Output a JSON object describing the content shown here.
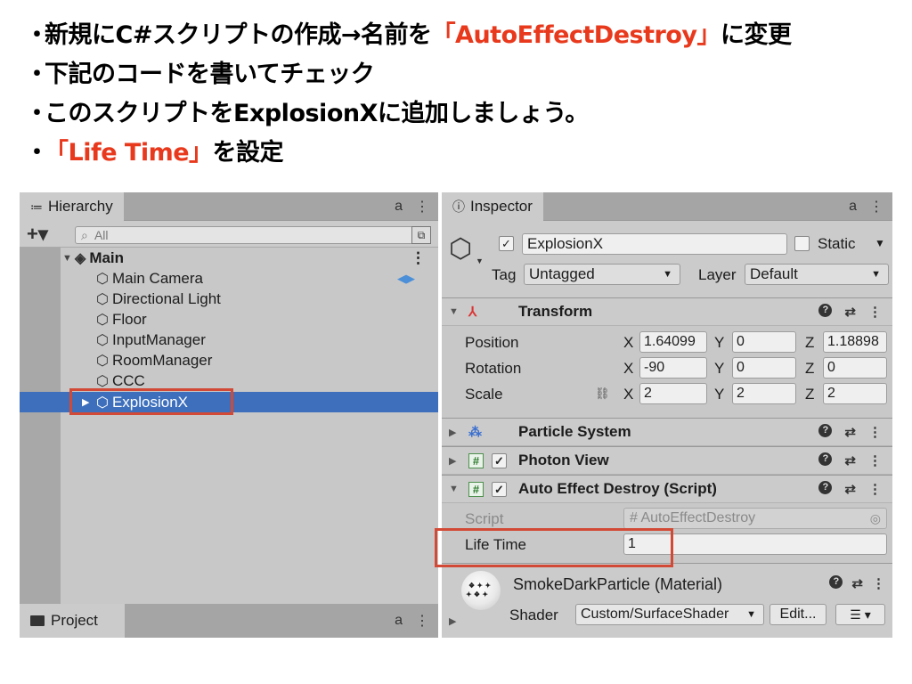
{
  "slide": {
    "bullets": [
      {
        "prefix": "新規にC#スクリプトの作成→名前を",
        "highlight": "「AutoEffectDestroy」",
        "suffix": "に変更"
      },
      {
        "prefix": "下記のコードを書いてチェック",
        "highlight": "",
        "suffix": ""
      },
      {
        "prefix": "このスクリプトをExplosionXに追加しましょう。",
        "highlight": "",
        "suffix": ""
      },
      {
        "prefix": "",
        "highlight": "「Life Time」",
        "suffix": "を設定"
      }
    ],
    "bullet_mark": "・",
    "highlight_color": "#e8391d",
    "annotation_color": "#d24a36"
  },
  "hierarchy": {
    "tab_label": "Hierarchy",
    "tab_icon": "≔",
    "lock_icon": "a",
    "menu_icon": "⋮",
    "add_label": "+▾",
    "search_icon": "⌕",
    "search_placeholder": "All",
    "scene_picker_icon": "⧉",
    "scene": "Main",
    "items": [
      {
        "label": "Main Camera",
        "badge": "◀▶"
      },
      {
        "label": "Directional Light"
      },
      {
        "label": "Floor"
      },
      {
        "label": "InputManager"
      },
      {
        "label": "RoomManager"
      },
      {
        "label": "CCC"
      },
      {
        "label": "ExplosionX",
        "selected": true
      }
    ],
    "project_tab": "Project"
  },
  "inspector": {
    "tab_label": "Inspector",
    "tab_icon": "ⓘ",
    "object_name": "ExplosionX",
    "active_check": "✓",
    "static_label": "Static",
    "tag_label": "Tag",
    "tag_value": "Untagged",
    "layer_label": "Layer",
    "layer_value": "Default",
    "transform": {
      "title": "Transform",
      "rows": [
        {
          "label": "Position",
          "x": "1.64099",
          "y": "0",
          "z": "1.18898"
        },
        {
          "label": "Rotation",
          "x": "-90",
          "y": "0",
          "z": "0"
        },
        {
          "label": "Scale",
          "x": "2",
          "y": "2",
          "z": "2"
        }
      ],
      "axis_x": "X",
      "axis_y": "Y",
      "axis_z": "Z"
    },
    "components": [
      {
        "title": "Particle System",
        "expanded": false
      },
      {
        "title": "Photon View",
        "expanded": false
      },
      {
        "title": "Auto Effect Destroy (Script)",
        "expanded": true
      }
    ],
    "script": {
      "label": "Script",
      "value": "AutoEffectDestroy",
      "life_time_label": "Life Time",
      "life_time_value": "1"
    },
    "material": {
      "name": "SmokeDarkParticle (Material)",
      "shader_label": "Shader",
      "shader_value": "Custom/SurfaceShader",
      "edit_label": "Edit...",
      "list_label": "☰ ▾"
    }
  }
}
